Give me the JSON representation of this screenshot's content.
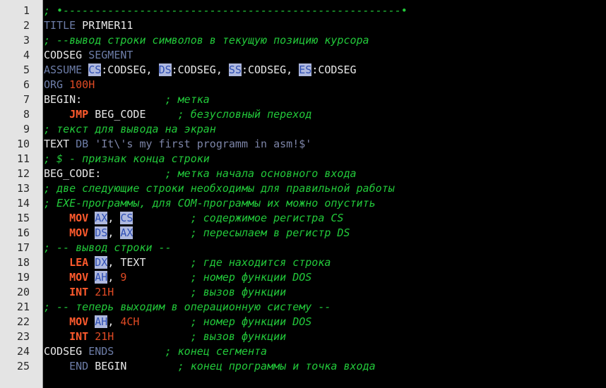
{
  "editor": {
    "language": "asm",
    "colors": {
      "background": "#000000",
      "gutter": "#e4e4e4",
      "comment": "#22c93a",
      "keyword": "#6d7da8",
      "instruction": "#ff5a2d",
      "register_bg": "#aeb8de",
      "register_text": "#2f4fb4",
      "number": "#e04a24",
      "string": "#7d85a8",
      "plain": "#e8e8e8"
    },
    "lines": [
      {
        "n": "1",
        "tokens": [
          {
            "t": "; •-----------------------------------------------------•",
            "c": "comment"
          }
        ]
      },
      {
        "n": "2",
        "tokens": [
          {
            "t": "TITLE",
            "c": "kw"
          },
          {
            "t": " PRIMER11",
            "c": "plain"
          }
        ]
      },
      {
        "n": "3",
        "tokens": [
          {
            "t": "; --вывод строки символов в текущую позицию курсора",
            "c": "comment"
          }
        ]
      },
      {
        "n": "4",
        "tokens": [
          {
            "t": "CODSEG ",
            "c": "plain"
          },
          {
            "t": "SEGMENT",
            "c": "kw"
          }
        ]
      },
      {
        "n": "5",
        "tokens": [
          {
            "t": "ASSUME ",
            "c": "kw"
          },
          {
            "t": "CS",
            "c": "reg"
          },
          {
            "t": ":CODSEG, ",
            "c": "plain"
          },
          {
            "t": "DS",
            "c": "reg"
          },
          {
            "t": ":CODSEG, ",
            "c": "plain"
          },
          {
            "t": "SS",
            "c": "reg"
          },
          {
            "t": ":CODSEG, ",
            "c": "plain"
          },
          {
            "t": "ES",
            "c": "reg"
          },
          {
            "t": ":CODSEG",
            "c": "plain"
          }
        ]
      },
      {
        "n": "6",
        "tokens": [
          {
            "t": "ORG",
            "c": "kw"
          },
          {
            "t": " ",
            "c": "plain"
          },
          {
            "t": "100H",
            "c": "num"
          }
        ]
      },
      {
        "n": "7",
        "tokens": [
          {
            "t": "BEGIN:             ",
            "c": "plain"
          },
          {
            "t": "; метка",
            "c": "comment"
          }
        ]
      },
      {
        "n": "8",
        "tokens": [
          {
            "t": "    ",
            "c": "plain"
          },
          {
            "t": "JMP",
            "c": "instr"
          },
          {
            "t": " BEG_CODE     ",
            "c": "plain"
          },
          {
            "t": "; безусловный переход",
            "c": "comment"
          }
        ]
      },
      {
        "n": "9",
        "tokens": [
          {
            "t": "; текст для вывода на экран",
            "c": "comment"
          }
        ]
      },
      {
        "n": "10",
        "tokens": [
          {
            "t": "TEXT ",
            "c": "plain"
          },
          {
            "t": "DB",
            "c": "kw"
          },
          {
            "t": " ",
            "c": "plain"
          },
          {
            "t": "'It\\'s my first programm in asm!$'",
            "c": "str"
          }
        ]
      },
      {
        "n": "11",
        "tokens": [
          {
            "t": "; $ - признак конца строки",
            "c": "comment"
          }
        ]
      },
      {
        "n": "12",
        "tokens": [
          {
            "t": "BEG_CODE:          ",
            "c": "plain"
          },
          {
            "t": "; метка начала основного входа",
            "c": "comment"
          }
        ]
      },
      {
        "n": "13",
        "tokens": [
          {
            "t": "; две следующие строки необходимы для правильной работы",
            "c": "comment"
          }
        ]
      },
      {
        "n": "14",
        "tokens": [
          {
            "t": "; EXE-программы, для COM-программы их можно опустить",
            "c": "comment"
          }
        ]
      },
      {
        "n": "15",
        "tokens": [
          {
            "t": "    ",
            "c": "plain"
          },
          {
            "t": "MOV",
            "c": "instr"
          },
          {
            "t": " ",
            "c": "plain"
          },
          {
            "t": "AX",
            "c": "reg"
          },
          {
            "t": ", ",
            "c": "plain"
          },
          {
            "t": "CS",
            "c": "reg"
          },
          {
            "t": "         ",
            "c": "plain"
          },
          {
            "t": "; содержимое регистра CS",
            "c": "comment"
          }
        ]
      },
      {
        "n": "16",
        "tokens": [
          {
            "t": "    ",
            "c": "plain"
          },
          {
            "t": "MOV",
            "c": "instr"
          },
          {
            "t": " ",
            "c": "plain"
          },
          {
            "t": "DS",
            "c": "reg"
          },
          {
            "t": ", ",
            "c": "plain"
          },
          {
            "t": "AX",
            "c": "reg"
          },
          {
            "t": "         ",
            "c": "plain"
          },
          {
            "t": "; пересылаем в регистр DS",
            "c": "comment"
          }
        ]
      },
      {
        "n": "17",
        "tokens": [
          {
            "t": "; -- вывод строки --",
            "c": "comment"
          }
        ]
      },
      {
        "n": "18",
        "tokens": [
          {
            "t": "    ",
            "c": "plain"
          },
          {
            "t": "LEA",
            "c": "instr"
          },
          {
            "t": " ",
            "c": "plain"
          },
          {
            "t": "DX",
            "c": "reg"
          },
          {
            "t": ", TEXT       ",
            "c": "plain"
          },
          {
            "t": "; где находится строка",
            "c": "comment"
          }
        ]
      },
      {
        "n": "19",
        "tokens": [
          {
            "t": "    ",
            "c": "plain"
          },
          {
            "t": "MOV",
            "c": "instr"
          },
          {
            "t": " ",
            "c": "plain"
          },
          {
            "t": "AH",
            "c": "reg"
          },
          {
            "t": ", ",
            "c": "plain"
          },
          {
            "t": "9",
            "c": "num"
          },
          {
            "t": "          ",
            "c": "plain"
          },
          {
            "t": "; номер функции DOS",
            "c": "comment"
          }
        ]
      },
      {
        "n": "20",
        "tokens": [
          {
            "t": "    ",
            "c": "plain"
          },
          {
            "t": "INT",
            "c": "instr"
          },
          {
            "t": " ",
            "c": "plain"
          },
          {
            "t": "21H",
            "c": "num"
          },
          {
            "t": "            ",
            "c": "plain"
          },
          {
            "t": "; вызов функции",
            "c": "comment"
          }
        ]
      },
      {
        "n": "21",
        "tokens": [
          {
            "t": "; -- теперь выходим в операционную систему --",
            "c": "comment"
          }
        ]
      },
      {
        "n": "22",
        "tokens": [
          {
            "t": "    ",
            "c": "plain"
          },
          {
            "t": "MOV",
            "c": "instr"
          },
          {
            "t": " ",
            "c": "plain"
          },
          {
            "t": "AH",
            "c": "reg"
          },
          {
            "t": ", ",
            "c": "plain"
          },
          {
            "t": "4CH",
            "c": "num"
          },
          {
            "t": "        ",
            "c": "plain"
          },
          {
            "t": "; номер функции DOS",
            "c": "comment"
          }
        ]
      },
      {
        "n": "23",
        "tokens": [
          {
            "t": "    ",
            "c": "plain"
          },
          {
            "t": "INT",
            "c": "instr"
          },
          {
            "t": " ",
            "c": "plain"
          },
          {
            "t": "21H",
            "c": "num"
          },
          {
            "t": "            ",
            "c": "plain"
          },
          {
            "t": "; вызов функции",
            "c": "comment"
          }
        ]
      },
      {
        "n": "24",
        "tokens": [
          {
            "t": "CODSEG ",
            "c": "plain"
          },
          {
            "t": "ENDS",
            "c": "kw"
          },
          {
            "t": "        ",
            "c": "plain"
          },
          {
            "t": "; конец сегмента",
            "c": "comment"
          }
        ]
      },
      {
        "n": "25",
        "tokens": [
          {
            "t": "    ",
            "c": "plain"
          },
          {
            "t": "END",
            "c": "kw"
          },
          {
            "t": " BEGIN        ",
            "c": "plain"
          },
          {
            "t": "; конец программы и точка входа",
            "c": "comment"
          }
        ]
      }
    ]
  }
}
